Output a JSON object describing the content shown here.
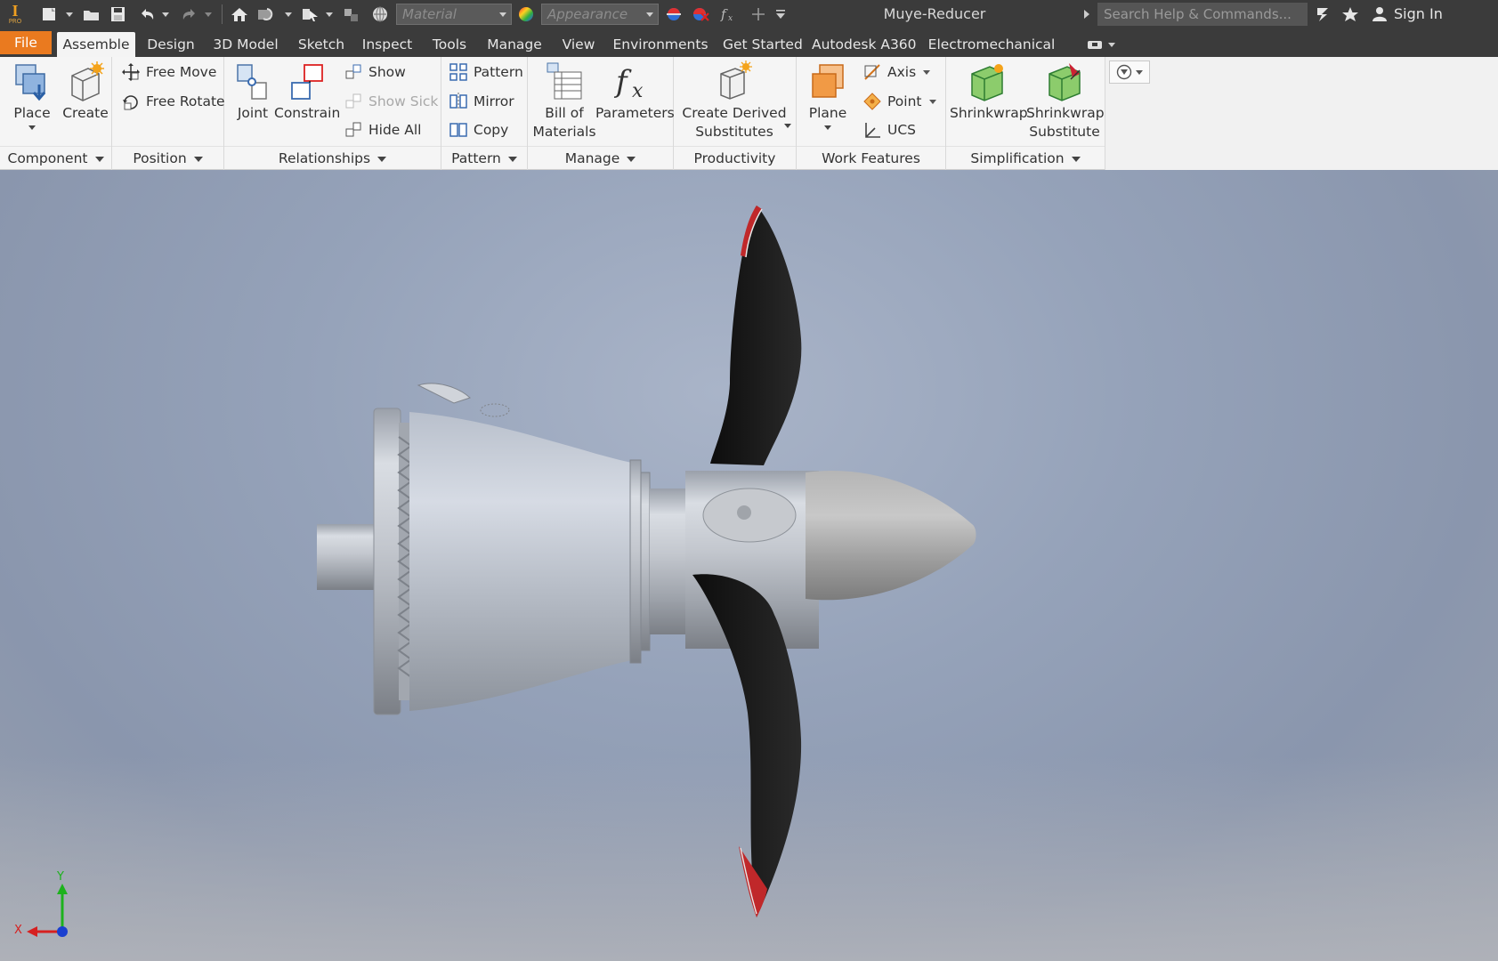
{
  "app": {
    "logo_text": "I",
    "logo_sub": "PRO",
    "document_title": "Muye-Reducer"
  },
  "quick_access": {
    "material_placeholder": "Material",
    "appearance_placeholder": "Appearance",
    "search_placeholder": "Search Help & Commands...",
    "sign_in_label": "Sign In"
  },
  "tabs": [
    {
      "label": "File"
    },
    {
      "label": "Assemble"
    },
    {
      "label": "Design"
    },
    {
      "label": "3D Model"
    },
    {
      "label": "Sketch"
    },
    {
      "label": "Inspect"
    },
    {
      "label": "Tools"
    },
    {
      "label": "Manage"
    },
    {
      "label": "View"
    },
    {
      "label": "Environments"
    },
    {
      "label": "Get Started"
    },
    {
      "label": "Autodesk A360"
    },
    {
      "label": "Electromechanical"
    }
  ],
  "active_tab": "Assemble",
  "ribbon": {
    "component": {
      "title": "Component",
      "place": "Place",
      "create": "Create"
    },
    "position": {
      "title": "Position",
      "free_move": "Free Move",
      "free_rotate": "Free Rotate"
    },
    "relationships": {
      "title": "Relationships",
      "joint": "Joint",
      "constrain": "Constrain",
      "show": "Show",
      "show_sick": "Show Sick",
      "hide_all": "Hide All"
    },
    "pattern": {
      "title": "Pattern",
      "pattern": "Pattern",
      "mirror": "Mirror",
      "copy": "Copy"
    },
    "manage": {
      "title": "Manage",
      "bom_line1": "Bill of",
      "bom_line2": "Materials",
      "parameters": "Parameters"
    },
    "productivity": {
      "title": "Productivity",
      "derived_line1": "Create Derived",
      "derived_line2": "Substitutes"
    },
    "work_features": {
      "title": "Work Features",
      "plane": "Plane",
      "axis": "Axis",
      "point": "Point",
      "ucs": "UCS"
    },
    "simplification": {
      "title": "Simplification",
      "shrinkwrap": "Shrinkwrap",
      "shrinkwrap_sub_line1": "Shrinkwrap",
      "shrinkwrap_sub_line2": "Substitute"
    }
  },
  "viewcube": {
    "x_label": "X",
    "y_label": "Y"
  },
  "colors": {
    "file_tab": "#ea7a1f",
    "title_bar": "#3b3b3b",
    "ribbon_bg": "#f5f5f5",
    "blade": "#1a1a1a",
    "blade_tip": "#c0282a",
    "axis_x": "#d62020",
    "axis_y": "#1db21d",
    "axis_z": "#1a3fd0"
  }
}
